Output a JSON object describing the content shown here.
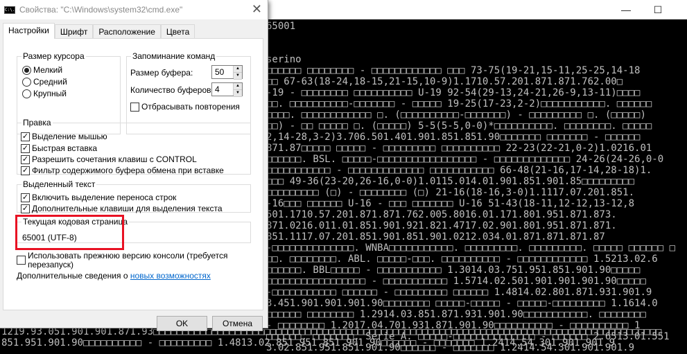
{
  "console": {
    "window_controls": {
      "minimize": "—",
      "maximize": "☐"
    },
    "lines": [
      "65001",
      "",
      "",
      "serino",
      "□□□□□□ □□□□□□□□ - □□□□□□□□□□□□ □□□ 73-75(19-21,15-11,25-25,14-18",
      "□□ 67-63(18-24,18-15,21-15,10-9)1.1710.57.201.871.871.762.00□",
      "-19 - □□□□□□□□ □□□□□□□□□□ U-19 92-54(29-13,24-21,26-9,13-11)□□□□",
      "□□. □□□□□□□□□□-□□□□□□□ - □□□□□ 19-25(17-23,2-2)□□□□□□□□□□□. □□□□□□",
      "□□□□. □□□□□□□□□□□□ □. (□□□□□□□□□□-□□□□□□□) - □□□□□□□□□ □. (□□□□□)",
      "□□) - □□ □□□□□ □. (□□□□□) 5-5(5-5,0-0)*□□□□□□□□□□. □□□□□□□□. □□□□□",
      "2,14-28,3-2)3.706.501.401.901.851.851.90□□□□□□□ □□□□□□□ - □□□□□□",
      "871.87□□□□□ □□□□□ - □□□□□□□□□ □□□□□□□□□□ 22-23(22-21,0-2)1.0216.01",
      "□□□□□□. BSL. □□□□□-□□□□□□□□□□□□□□□□□ - □□□□□□□□□□□□□ 24-26(24-26,0-0",
      "□□□□□□□□□□□ - □□□□□□□□□□□□□ □□□□□□□□□□□ 66-48(21-16,17-14,28-18)1.",
      "□□□ 49-36(23-20,26-16,0-0)1.0115.014.01.901.851.901.85□□□□□□□□□",
      "□□□□□□□□□ (□) - □□□□□□□□ (□) 21-16(18-16,3-0)1.1117.07.201.851.",
      "-16□□□ □□□□□□ U-16 - □□□ □□□□□□□ U-16 51-43(18-11,12-12,13-12,8",
      "501.1710.57.201.871.871.762.005.8016.01.171.801.951.871.873.",
      "871.0216.011.01.851.901.921.821.4717.02.901.801.951.871.871.",
      "851.1117.07.201.851.901.851.901.0212.034.01.871.871.871.87",
      "-□□□□□□□□□□□□□□. WNBA□□□□□□□□□□□. □□□□□□□□□. □□□□□□□□□. □□□□□ □□□□□□ □",
      "□□. □□□□□□□□. ABL. □□□□□-□□□. □□□□□□□□□□ - □□□□□□□□□□□□ 1.5213.02.6",
      "□□□□□□. BBL□□□□□ - □□□□□□□□□□□ 1.3014.03.751.951.851.901.90□□□□□",
      "□□□□□□□□□□□□□□□□□ - □□□□□□□□□□□ 1.5714.02.501.901.901.901.90□□□□□",
      "-□□□□□□□□□□□ □□□□□□ - □□□□□□□□□ □□□□□□ 1.4814.02.801.871.931.901.9",
      "3.451.901.901.901.90□□□□□□□□ □□□□□-□□□□□ - □□□□□-□□□□□□□□□ 1.1614.0",
      "□□□□□□ □□□□□□□□ 1.2914.03.851.871.931.901.90□□□□□□□□□□□. □□□□□□□□",
      "- □□□□□□□□ 1.2017.04.701.931.871.901.90□□□□□□□□□□ - □□□□□□□□□□ 1",
      "□□□□□□. □□□□□□□. Serie A. □□□□□-□□□□□□□□□□□□□□ - □□□□□□ 2.6513.01.551",
      "3.02.851.951.851.901.90□□□□□□ - □□□□□□□ 1.2414.54.301.901.901.9"
    ],
    "bottom_lines": [
      "1219.93.051.901.901.871.93□□□□□□□□□□□□□□□□□□□□□□□□□□□□□□□□□□□□□□□□□□□□□□□□□□□□□□□□□□□□□□□□□□□□□□□□□□□□□□□□□□□□□□□",
      "851.951.901.90□□□□□□□□□□ - □□□□□□□□□ 1.4813.02.851.951.851.901.90□□□□□□ - □□□□□□□ 1.2414.54.301.901.901.9"
    ]
  },
  "dialog": {
    "title": "Свойства: \"C:\\Windows\\system32\\cmd.exe\"",
    "icon_label": "C:\\.",
    "close": "✕",
    "tabs": [
      "Настройки",
      "Шрифт",
      "Расположение",
      "Цвета"
    ],
    "active_tab": "Настройки",
    "cursor_size": {
      "legend": "Размер курсора",
      "options": [
        "Мелкий",
        "Средний",
        "Крупный"
      ],
      "selected": "Мелкий"
    },
    "command_history": {
      "legend": "Запоминание команд",
      "buffer_size_label": "Размер буфера:",
      "buffer_size": "50",
      "buffer_count_label": "Количество буферов:",
      "buffer_count": "4",
      "discard_duplicates_label": "Отбрасывать повторения",
      "discard_duplicates": false
    },
    "edit": {
      "legend": "Правка",
      "options": [
        {
          "label": "Выделение мышью",
          "checked": true
        },
        {
          "label": "Быстрая вставка",
          "checked": true
        },
        {
          "label": "Разрешить сочетания клавиш с CONTROL",
          "checked": true
        },
        {
          "label": "Фильтр содержимого буфера обмена при вставке",
          "checked": true
        }
      ]
    },
    "selected_text": {
      "legend": "Выделенный текст",
      "options": [
        {
          "label": "Включить выделение переноса строк",
          "checked": true
        },
        {
          "label": "Дополнительные клавиши для выделения текста",
          "checked": true
        }
      ]
    },
    "codepage": {
      "legend": "Текущая кодовая страница",
      "value": "65001 (UTF-8)",
      "highlight_color": "#e81123"
    },
    "legacy_console": {
      "label_line1": "Использовать прежнюю версию консоли (требуется",
      "label_line2": "перезапуск)",
      "checked": false
    },
    "more_info": {
      "text": "Дополнительные сведения о",
      "link": "новых возможностях"
    },
    "ok": "OK",
    "cancel": "Отмена"
  }
}
